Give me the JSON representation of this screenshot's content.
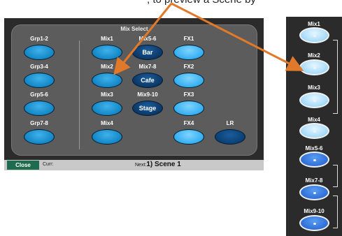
{
  "top_caption": ", to preview a Scene by",
  "main": {
    "title": "Mix Select",
    "groups": [
      {
        "label": "Grp1-2"
      },
      {
        "label": "Grp3-4"
      },
      {
        "label": "Grp5-6"
      },
      {
        "label": "Grp7-8"
      }
    ],
    "mixes": [
      {
        "label": "Mix1"
      },
      {
        "label": "Mix2"
      },
      {
        "label": "Mix3"
      },
      {
        "label": "Mix4"
      }
    ],
    "custom": [
      {
        "label": "Mix5-6",
        "value": "Bar"
      },
      {
        "label": "Mix7-8",
        "value": "Cafe"
      },
      {
        "label": "Mix9-10",
        "value": "Stage"
      }
    ],
    "fx": [
      {
        "label": "FX1"
      },
      {
        "label": "FX2"
      },
      {
        "label": "FX3"
      },
      {
        "label": "FX4"
      }
    ],
    "lr": {
      "label": "LR"
    }
  },
  "status_bar": {
    "close": "Close",
    "curr": "Curr:",
    "next_prefix": "Next:",
    "next_scene": "1) Scene 1"
  },
  "right_panel": {
    "items": [
      {
        "label": "Mix1"
      },
      {
        "label": "Mix2"
      },
      {
        "label": "Mix3"
      },
      {
        "label": "Mix4"
      },
      {
        "label": "Mix5-6"
      },
      {
        "label": "Mix7-8"
      },
      {
        "label": "Mix9-10"
      }
    ]
  },
  "colors": {
    "arrow": "#e07a2a",
    "panel": "#2b2b2b",
    "group_button": "#1689c9",
    "fx_button": "#35aef0",
    "custom_button": "#0b3564"
  }
}
